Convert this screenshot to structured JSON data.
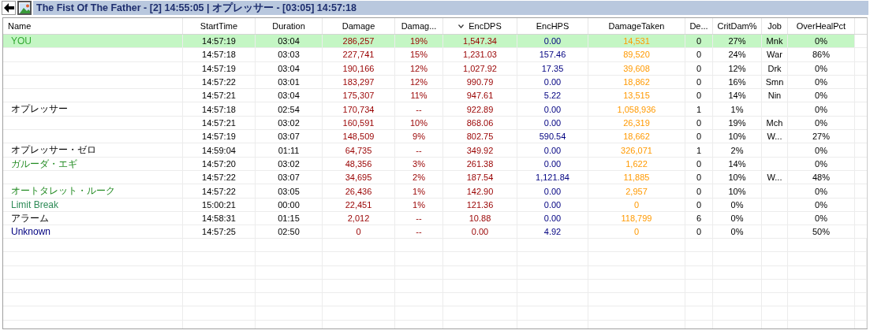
{
  "title_bar": {
    "title": "The Fist Of The Father - [2] 14:55:05 | オプレッサー - [03:05] 14:57:18"
  },
  "table": {
    "columns": [
      {
        "label": "Name",
        "sorted": false
      },
      {
        "label": "StartTime",
        "sorted": false
      },
      {
        "label": "Duration",
        "sorted": false
      },
      {
        "label": "Damage",
        "sorted": false
      },
      {
        "label": "Damag...",
        "sorted": false
      },
      {
        "label": "EncDPS",
        "sorted": true
      },
      {
        "label": "EncHPS",
        "sorted": false
      },
      {
        "label": "DamageTaken",
        "sorted": false
      },
      {
        "label": "De...",
        "sorted": false
      },
      {
        "label": "CritDam%",
        "sorted": false
      },
      {
        "label": "Job",
        "sorted": false
      },
      {
        "label": "OverHealPct",
        "sorted": false
      }
    ],
    "rows": [
      {
        "selected": true,
        "name": "YOU",
        "color": "#33aa33",
        "start_time": "14:57:19",
        "duration": "03:04",
        "damage": "286,257",
        "damage_pct": "19%",
        "enc_dps": "1,547.34",
        "enc_hps": "0.00",
        "damage_taken": "14,531",
        "deaths": "0",
        "crit_dam_pct": "27%",
        "job": "Mnk",
        "overheal_pct": "0%"
      },
      {
        "selected": false,
        "start_time": "14:57:18",
        "duration": "03:03",
        "damage": "227,741",
        "damage_pct": "15%",
        "enc_dps": "1,231.03",
        "enc_hps": "157.46",
        "damage_taken": "89,520",
        "deaths": "0",
        "crit_dam_pct": "24%",
        "job": "War",
        "overheal_pct": "86%"
      },
      {
        "selected": false,
        "start_time": "14:57:19",
        "duration": "03:04",
        "damage": "190,166",
        "damage_pct": "12%",
        "enc_dps": "1,027.92",
        "enc_hps": "17.35",
        "damage_taken": "39,608",
        "deaths": "0",
        "crit_dam_pct": "12%",
        "job": "Drk",
        "overheal_pct": "0%"
      },
      {
        "selected": false,
        "start_time": "14:57:22",
        "duration": "03:01",
        "damage": "183,297",
        "damage_pct": "12%",
        "enc_dps": "990.79",
        "enc_hps": "0.00",
        "damage_taken": "18,862",
        "deaths": "0",
        "crit_dam_pct": "16%",
        "job": "Smn",
        "overheal_pct": "0%"
      },
      {
        "selected": false,
        "start_time": "14:57:21",
        "duration": "03:04",
        "damage": "175,307",
        "damage_pct": "11%",
        "enc_dps": "947.61",
        "enc_hps": "5.22",
        "damage_taken": "13,515",
        "deaths": "0",
        "crit_dam_pct": "14%",
        "job": "Nin",
        "overheal_pct": "0%"
      },
      {
        "selected": false,
        "name": "オプレッサー",
        "start_time": "14:57:18",
        "duration": "02:54",
        "damage": "170,734",
        "damage_pct": "--",
        "enc_dps": "922.89",
        "enc_hps": "0.00",
        "damage_taken": "1,058,936",
        "deaths": "1",
        "crit_dam_pct": "1%",
        "overheal_pct": "0%"
      },
      {
        "selected": false,
        "start_time": "14:57:21",
        "duration": "03:02",
        "damage": "160,591",
        "damage_pct": "10%",
        "enc_dps": "868.06",
        "enc_hps": "0.00",
        "damage_taken": "26,319",
        "deaths": "0",
        "crit_dam_pct": "19%",
        "job": "Mch",
        "overheal_pct": "0%"
      },
      {
        "selected": false,
        "start_time": "14:57:19",
        "duration": "03:07",
        "damage": "148,509",
        "damage_pct": "9%",
        "enc_dps": "802.75",
        "enc_hps": "590.54",
        "damage_taken": "18,662",
        "deaths": "0",
        "crit_dam_pct": "10%",
        "job": "W...",
        "overheal_pct": "27%"
      },
      {
        "selected": false,
        "name": "オプレッサー・ゼロ",
        "start_time": "14:59:04",
        "duration": "01:11",
        "damage": "64,735",
        "damage_pct": "--",
        "enc_dps": "349.92",
        "enc_hps": "0.00",
        "damage_taken": "326,071",
        "deaths": "1",
        "crit_dam_pct": "2%",
        "overheal_pct": "0%"
      },
      {
        "selected": false,
        "name": "ガルーダ・エギ",
        "color": "#228b22",
        "start_time": "14:57:20",
        "duration": "03:02",
        "damage": "48,356",
        "damage_pct": "3%",
        "enc_dps": "261.38",
        "enc_hps": "0.00",
        "damage_taken": "1,622",
        "deaths": "0",
        "crit_dam_pct": "14%",
        "overheal_pct": "0%"
      },
      {
        "selected": false,
        "start_time": "14:57:22",
        "duration": "03:07",
        "damage": "34,695",
        "damage_pct": "2%",
        "enc_dps": "187.54",
        "enc_hps": "1,121.84",
        "damage_taken": "11,885",
        "deaths": "0",
        "crit_dam_pct": "10%",
        "job": "W...",
        "overheal_pct": "48%"
      },
      {
        "selected": false,
        "name": "オートタレット・ルーク",
        "color": "#228b22",
        "start_time": "14:57:22",
        "duration": "03:05",
        "damage": "26,436",
        "damage_pct": "1%",
        "enc_dps": "142.90",
        "enc_hps": "0.00",
        "damage_taken": "2,957",
        "deaths": "0",
        "crit_dam_pct": "10%",
        "overheal_pct": "0%"
      },
      {
        "selected": false,
        "name": "Limit Break",
        "color": "#2e8b57",
        "start_time": "15:00:21",
        "duration": "00:00",
        "damage": "22,451",
        "damage_pct": "1%",
        "enc_dps": "121.36",
        "enc_hps": "0.00",
        "damage_taken": "0",
        "deaths": "0",
        "crit_dam_pct": "0%",
        "overheal_pct": "0%"
      },
      {
        "selected": false,
        "name": "アラーム",
        "start_time": "14:58:31",
        "duration": "01:15",
        "damage": "2,012",
        "damage_pct": "--",
        "enc_dps": "10.88",
        "enc_hps": "0.00",
        "damage_taken": "118,799",
        "deaths": "6",
        "crit_dam_pct": "0%",
        "overheal_pct": "0%"
      },
      {
        "selected": false,
        "name": "Unknown",
        "color": "#000080",
        "start_time": "14:57:25",
        "duration": "02:50",
        "damage": "0",
        "damage_pct": "--",
        "enc_dps": "0.00",
        "enc_hps": "4.92",
        "damage_taken": "0",
        "deaths": "0",
        "crit_dam_pct": "0%",
        "overheal_pct": "50%"
      }
    ]
  }
}
